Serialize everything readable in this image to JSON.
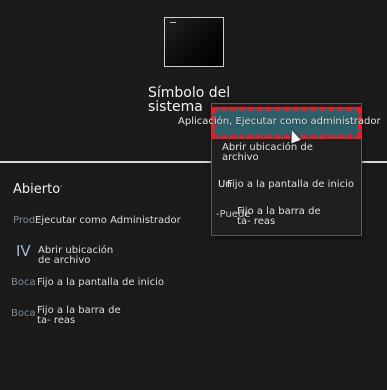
{
  "app": {
    "name": "Símbolo del sistema"
  },
  "tooltip": {
    "text": "Aplicación, Ejecutar como administrador"
  },
  "context_menu": {
    "items": [
      {
        "label": "Abrir ubicación de archivo"
      },
      {
        "label": "Fijo a la pantalla de inicio"
      },
      {
        "label": "Fijo a la barra de ta- reas"
      }
    ],
    "overlap_text": [
      "Un",
      "-Puede"
    ]
  },
  "jump_list": {
    "title": "Abierto",
    "items": [
      {
        "prefix": "Prod",
        "label": "Ejecutar como Administrador"
      },
      {
        "prefix": "IV",
        "label": "Abrir ubicación de archivo"
      },
      {
        "prefix": "Boca",
        "label": "Fijo a la pantalla de inicio"
      },
      {
        "prefix": "Boca",
        "label": "Fijo a la barra de ta- reas"
      }
    ]
  },
  "colors": {
    "background": "#1b1b1b",
    "highlight": "#2d5f6a",
    "highlight_border": "#e0202a",
    "separator": "#d9d9d9"
  },
  "icons": {
    "app_tile": "command-prompt-icon",
    "pointer": "mouse-pointer-icon"
  }
}
